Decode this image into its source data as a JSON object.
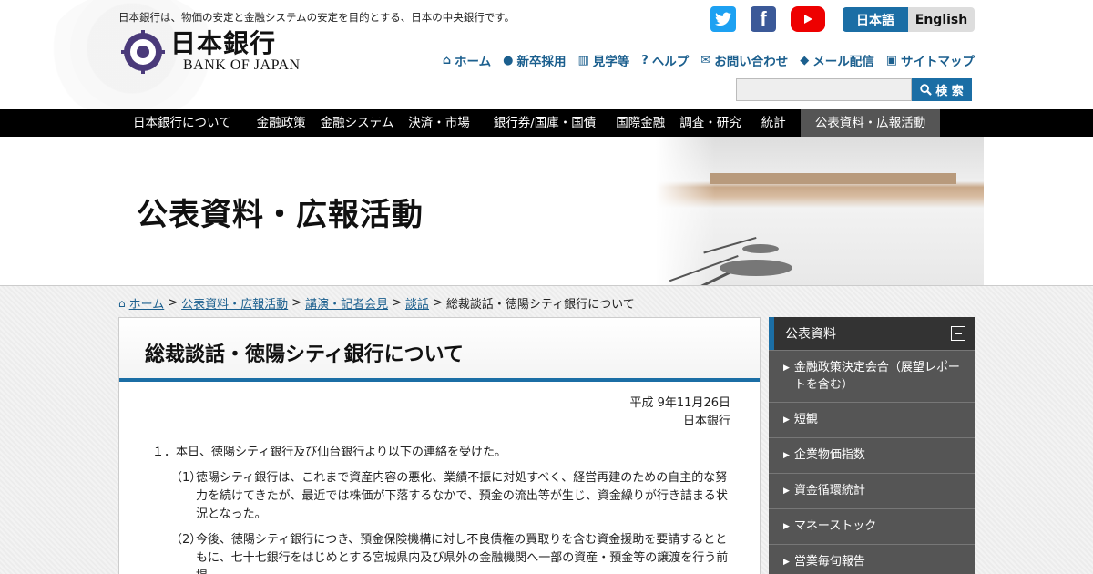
{
  "header": {
    "tagline": "日本銀行は、物価の安定と金融システムの安定を目的とする、日本の中央銀行です。",
    "logo_jp": "日本銀行",
    "logo_en": "BANK OF JAPAN",
    "social": {
      "twitter_icon": "twitter-icon",
      "facebook_glyph": "f",
      "youtube_icon": "youtube-icon"
    },
    "lang": {
      "ja": "日本語",
      "en": "English"
    },
    "utility_nav": [
      {
        "icon": "home-icon",
        "label": "ホーム"
      },
      {
        "icon": "person-icon",
        "label": "新卒採用"
      },
      {
        "icon": "building-icon",
        "label": "見学等"
      },
      {
        "icon": "help-icon",
        "label": "ヘルプ"
      },
      {
        "icon": "mail-icon",
        "label": "お問い合わせ"
      },
      {
        "icon": "box-icon",
        "label": "メール配信"
      },
      {
        "icon": "sitemap-icon",
        "label": "サイトマップ"
      }
    ],
    "search": {
      "placeholder": "",
      "button_label": "検 索"
    }
  },
  "main_nav": [
    {
      "label": "日本銀行について"
    },
    {
      "label": "金融政策"
    },
    {
      "label": "金融システム"
    },
    {
      "label": "決済・市場"
    },
    {
      "label": "銀行券/国庫・国債"
    },
    {
      "label": "国際金融"
    },
    {
      "label": "調査・研究"
    },
    {
      "label": "統計"
    },
    {
      "label": "公表資料・広報活動"
    }
  ],
  "hero": {
    "title": "公表資料・広報活動"
  },
  "breadcrumb": {
    "home": "ホーム",
    "items": [
      "公表資料・広報活動",
      "講演・記者会見",
      "談話"
    ],
    "current": "総裁談話・徳陽シティ銀行について",
    "sep": ">"
  },
  "article": {
    "title": "総裁談話・徳陽シティ銀行について",
    "date": "平成 9年11月26日",
    "author": "日本銀行",
    "para1": "１．本日、徳陽シティ銀行及び仙台銀行より以下の連絡を受けた。",
    "sub1_num": "（1）",
    "sub1_text": "徳陽シティ銀行は、これまで資産内容の悪化、業績不振に対処すべく、経営再建のための自主的な努力を続けてきたが、最近では株価が下落するなかで、預金の流出等が生じ、資金繰りが行き詰まる状況となった。",
    "sub2_num": "（2）",
    "sub2_text": "今後、徳陽シティ銀行につき、預金保険機構に対し不良債権の買取りを含む資金援助を要請するとともに、七十七銀行をはじめとする宮城県内及び県外の金融機関へ一部の資産・預金等の譲渡を行う前提"
  },
  "sidebar": {
    "heading": "公表資料",
    "items": [
      "金融政策決定会合（展望レポートを含む）",
      "短観",
      "企業物価指数",
      "資金循環統計",
      "マネーストック",
      "営業毎旬報告"
    ]
  },
  "colors": {
    "accent": "#1b6ea5",
    "nav_bg": "#000000",
    "sidebar_bg": "#555555"
  }
}
